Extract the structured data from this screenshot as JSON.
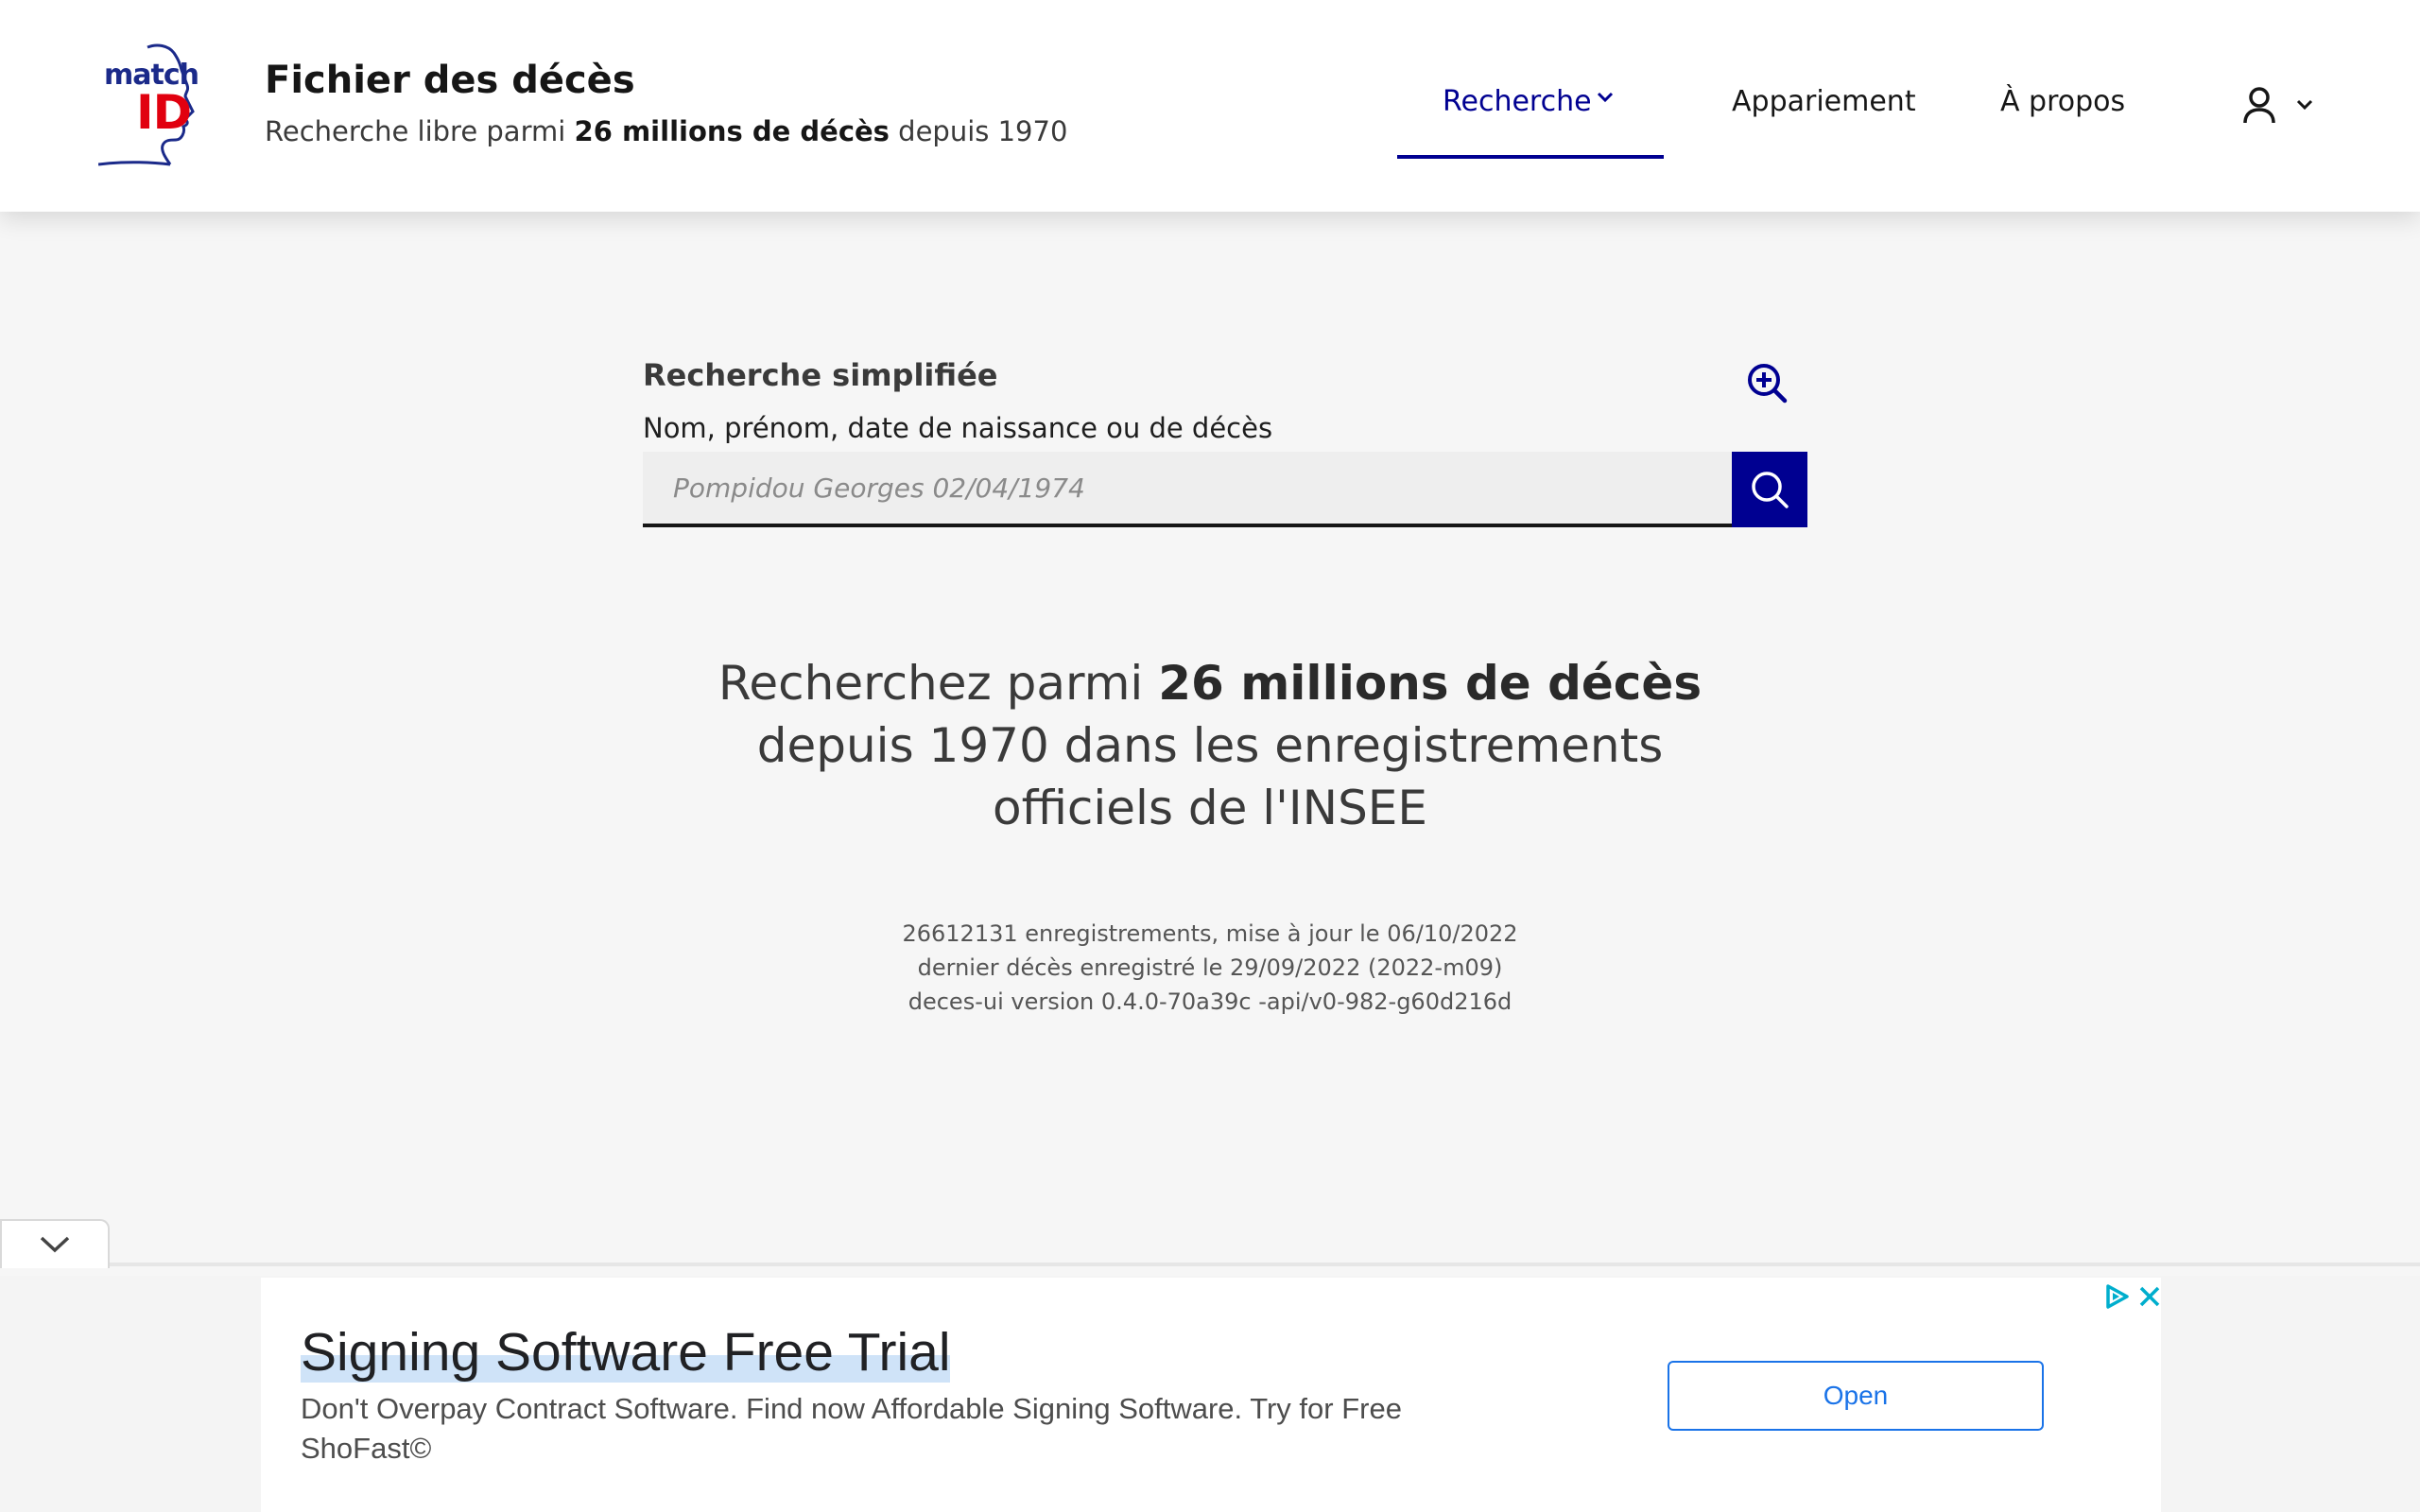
{
  "header": {
    "logo": {
      "match": "match",
      "id": "ID"
    },
    "title": "Fichier des décès",
    "subtitle_pre": "Recherche libre parmi ",
    "subtitle_bold": "26 millions de décès",
    "subtitle_post": " depuis 1970"
  },
  "nav": {
    "items": [
      {
        "label": "Recherche",
        "active": true
      },
      {
        "label": "Appariement"
      },
      {
        "label": "À propos"
      }
    ],
    "user_icon": "user-icon"
  },
  "search": {
    "heading": "Recherche simplifiée",
    "label": "Nom, prénom, date de naissance ou de décès",
    "placeholder": "Pompidou Georges 02/04/1974",
    "value": ""
  },
  "hero": {
    "pre": "Recherchez parmi ",
    "bold": "26 millions de décès",
    "post": " depuis 1970 dans les enregistrements officiels de l'INSEE"
  },
  "stats": {
    "line1": "26612131 enregistrements, mise à jour le 06/10/2022",
    "line2": "dernier décès enregistré le 29/09/2022 (2022-m09)",
    "line3": "deces-ui version 0.4.0-70a39c -api/v0-982-g60d216d"
  },
  "ad": {
    "title": "Signing Software Free Trial",
    "description": "Don't Overpay Contract Software. Find now Affordable Signing Software. Try for Free",
    "advertiser": "ShoFast©",
    "open_label": "Open"
  },
  "colors": {
    "primary": "#000091",
    "logo_red": "#e1000f",
    "ad_blue": "#1a73e8"
  }
}
